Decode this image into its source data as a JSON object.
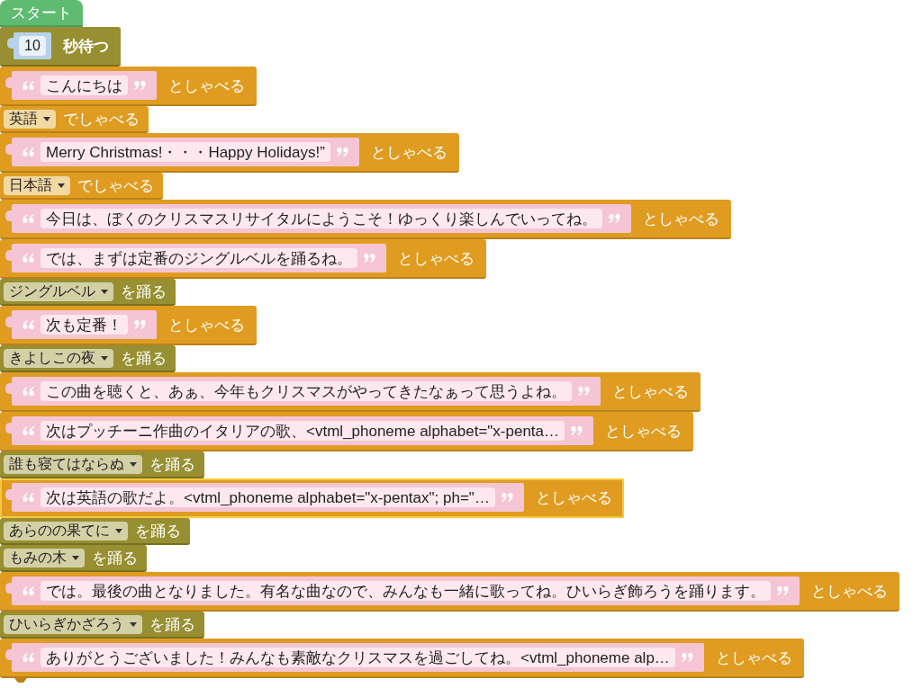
{
  "blocks": [
    {
      "kind": "start",
      "label": "スタート",
      "selected": false
    },
    {
      "kind": "wait",
      "value": "10",
      "label": "秒待つ",
      "selected": false
    },
    {
      "kind": "say",
      "text": "こんにちは",
      "label": "としゃべる",
      "selected": false
    },
    {
      "kind": "language",
      "option": "英語",
      "label": "でしゃべる",
      "selected": false
    },
    {
      "kind": "say",
      "text": "Merry Christmas!・・・Happy Holidays!”",
      "label": "としゃべる",
      "selected": false
    },
    {
      "kind": "language",
      "option": "日本語",
      "label": "でしゃべる",
      "selected": false
    },
    {
      "kind": "say",
      "text": "今日は、ぼくのクリスマスリサイタルにようこそ！ゆっくり楽しんでいってね。",
      "label": "としゃべる",
      "selected": false
    },
    {
      "kind": "say",
      "text": "では、まずは定番のジングルベルを踊るね。",
      "label": "としゃべる",
      "selected": false
    },
    {
      "kind": "dance",
      "option": "ジングルベル",
      "label": "を踊る",
      "selected": false
    },
    {
      "kind": "say",
      "text": "次も定番！",
      "label": "としゃべる",
      "selected": false
    },
    {
      "kind": "dance",
      "option": "きよしこの夜",
      "label": "を踊る",
      "selected": false
    },
    {
      "kind": "say",
      "text": "この曲を聴くと、あぁ、今年もクリスマスがやってきたなぁって思うよね。",
      "label": "としゃべる",
      "selected": false
    },
    {
      "kind": "say",
      "text": "次はプッチーニ作曲のイタリアの歌、<vtml_phoneme alphabet=\"x-penta…",
      "label": "としゃべる",
      "selected": false
    },
    {
      "kind": "dance",
      "option": "誰も寝てはならぬ",
      "label": "を踊る",
      "selected": false
    },
    {
      "kind": "say",
      "text": "次は英語の歌だよ。<vtml_phoneme alphabet=\"x-pentax\"; ph=\"…",
      "label": "としゃべる",
      "selected": true
    },
    {
      "kind": "dance",
      "option": "あらのの果てに",
      "label": "を踊る",
      "selected": false
    },
    {
      "kind": "dance",
      "option": "もみの木",
      "label": "を踊る",
      "selected": false
    },
    {
      "kind": "say",
      "text": "では。最後の曲となりました。有名な曲なので、みんなも一緒に歌ってね。ひいらぎ飾ろうを踊ります。",
      "label": "としゃべる",
      "selected": false
    },
    {
      "kind": "dance",
      "option": "ひいらぎかざろう",
      "label": "を踊る",
      "selected": false
    },
    {
      "kind": "say",
      "text": "ありがとうございました！みんなも素敵なクリスマスを過ごしてね。<vtml_phoneme alp…",
      "label": "としゃべる",
      "selected": false
    }
  ]
}
